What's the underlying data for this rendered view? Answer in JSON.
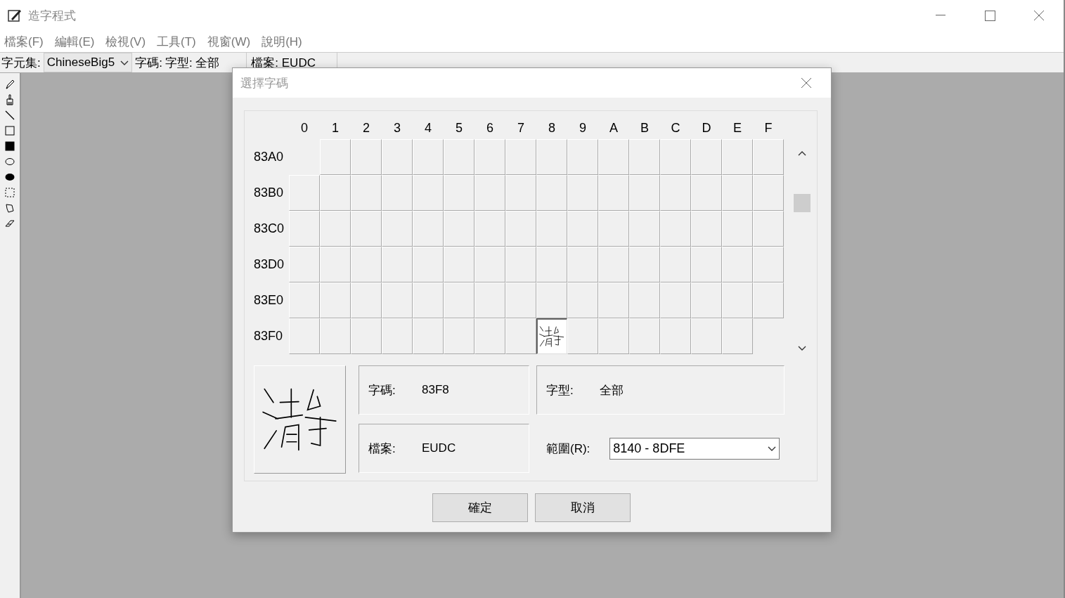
{
  "window": {
    "title": "造字程式"
  },
  "menu": [
    "檔案(F)",
    "編輯(E)",
    "檢視(V)",
    "工具(T)",
    "視窗(W)",
    "說明(H)"
  ],
  "toolbar": {
    "charset_label": "字元集:",
    "charset_value": "ChineseBig5",
    "code_label": "字碼:",
    "font_label": "字型: 全部",
    "file_label": "檔案: EUDC"
  },
  "dialog": {
    "title": "選擇字碼",
    "columns": [
      "0",
      "1",
      "2",
      "3",
      "4",
      "5",
      "6",
      "7",
      "8",
      "9",
      "A",
      "B",
      "C",
      "D",
      "E",
      "F"
    ],
    "rows": [
      {
        "label": "83A0",
        "cells": [
          {
            "kind": "none"
          },
          {
            "kind": "blank",
            "selected": false
          },
          {
            "kind": "blank",
            "selected": false
          },
          {
            "kind": "blank",
            "selected": false
          },
          {
            "kind": "blank",
            "selected": false
          },
          {
            "kind": "blank",
            "selected": false
          },
          {
            "kind": "blank",
            "selected": false
          },
          {
            "kind": "blank",
            "selected": false
          },
          {
            "kind": "blank",
            "selected": false
          },
          {
            "kind": "blank",
            "selected": false
          },
          {
            "kind": "blank",
            "selected": false
          },
          {
            "kind": "blank",
            "selected": false
          },
          {
            "kind": "blank",
            "selected": false
          },
          {
            "kind": "blank",
            "selected": false
          },
          {
            "kind": "blank",
            "selected": false
          },
          {
            "kind": "blank",
            "selected": false
          }
        ]
      },
      {
        "label": "83B0",
        "cells": [
          {
            "kind": "blank",
            "selected": false
          },
          {
            "kind": "blank",
            "selected": false
          },
          {
            "kind": "blank",
            "selected": false
          },
          {
            "kind": "blank",
            "selected": false
          },
          {
            "kind": "blank",
            "selected": false
          },
          {
            "kind": "blank",
            "selected": false
          },
          {
            "kind": "blank",
            "selected": false
          },
          {
            "kind": "blank",
            "selected": false
          },
          {
            "kind": "blank",
            "selected": false
          },
          {
            "kind": "blank",
            "selected": false
          },
          {
            "kind": "blank",
            "selected": false
          },
          {
            "kind": "blank",
            "selected": false
          },
          {
            "kind": "blank",
            "selected": false
          },
          {
            "kind": "blank",
            "selected": false
          },
          {
            "kind": "blank",
            "selected": false
          },
          {
            "kind": "blank",
            "selected": false
          }
        ]
      },
      {
        "label": "83C0",
        "cells": [
          {
            "kind": "blank",
            "selected": false
          },
          {
            "kind": "blank",
            "selected": false
          },
          {
            "kind": "blank",
            "selected": false
          },
          {
            "kind": "blank",
            "selected": false
          },
          {
            "kind": "blank",
            "selected": false
          },
          {
            "kind": "blank",
            "selected": false
          },
          {
            "kind": "blank",
            "selected": false
          },
          {
            "kind": "blank",
            "selected": false
          },
          {
            "kind": "blank",
            "selected": false
          },
          {
            "kind": "blank",
            "selected": false
          },
          {
            "kind": "blank",
            "selected": false
          },
          {
            "kind": "blank",
            "selected": false
          },
          {
            "kind": "blank",
            "selected": false
          },
          {
            "kind": "blank",
            "selected": false
          },
          {
            "kind": "blank",
            "selected": false
          },
          {
            "kind": "blank",
            "selected": false
          }
        ]
      },
      {
        "label": "83D0",
        "cells": [
          {
            "kind": "blank",
            "selected": false
          },
          {
            "kind": "blank",
            "selected": false
          },
          {
            "kind": "blank",
            "selected": false
          },
          {
            "kind": "blank",
            "selected": false
          },
          {
            "kind": "blank",
            "selected": false
          },
          {
            "kind": "blank",
            "selected": false
          },
          {
            "kind": "blank",
            "selected": false
          },
          {
            "kind": "blank",
            "selected": false
          },
          {
            "kind": "blank",
            "selected": false
          },
          {
            "kind": "blank",
            "selected": false
          },
          {
            "kind": "blank",
            "selected": false
          },
          {
            "kind": "blank",
            "selected": false
          },
          {
            "kind": "blank",
            "selected": false
          },
          {
            "kind": "blank",
            "selected": false
          },
          {
            "kind": "blank",
            "selected": false
          },
          {
            "kind": "blank",
            "selected": false
          }
        ]
      },
      {
        "label": "83E0",
        "cells": [
          {
            "kind": "blank",
            "selected": false
          },
          {
            "kind": "blank",
            "selected": false
          },
          {
            "kind": "blank",
            "selected": false
          },
          {
            "kind": "blank",
            "selected": false
          },
          {
            "kind": "blank",
            "selected": false
          },
          {
            "kind": "blank",
            "selected": false
          },
          {
            "kind": "blank",
            "selected": false
          },
          {
            "kind": "blank",
            "selected": false
          },
          {
            "kind": "blank",
            "selected": false
          },
          {
            "kind": "blank",
            "selected": false
          },
          {
            "kind": "blank",
            "selected": false
          },
          {
            "kind": "blank",
            "selected": false
          },
          {
            "kind": "blank",
            "selected": false
          },
          {
            "kind": "blank",
            "selected": false
          },
          {
            "kind": "blank",
            "selected": false
          },
          {
            "kind": "blank",
            "selected": false
          }
        ]
      },
      {
        "label": "83F0",
        "cells": [
          {
            "kind": "blank",
            "selected": false
          },
          {
            "kind": "blank",
            "selected": false
          },
          {
            "kind": "blank",
            "selected": false
          },
          {
            "kind": "blank",
            "selected": false
          },
          {
            "kind": "blank",
            "selected": false
          },
          {
            "kind": "blank",
            "selected": false
          },
          {
            "kind": "blank",
            "selected": false
          },
          {
            "kind": "blank",
            "selected": false
          },
          {
            "kind": "glyph",
            "selected": true
          },
          {
            "kind": "blank",
            "selected": false
          },
          {
            "kind": "blank",
            "selected": false
          },
          {
            "kind": "blank",
            "selected": false
          },
          {
            "kind": "blank",
            "selected": false
          },
          {
            "kind": "blank",
            "selected": false
          },
          {
            "kind": "blank",
            "selected": false
          },
          {
            "kind": "none"
          }
        ]
      }
    ],
    "code_label": "字碼:",
    "code_value": "83F8",
    "font_label": "字型:",
    "font_value": "全部",
    "file_label": "檔案:",
    "file_value": "EUDC",
    "range_label": "範圍(R):",
    "range_value": "8140 - 8DFE",
    "buttons": [
      "確定",
      "取消"
    ]
  }
}
